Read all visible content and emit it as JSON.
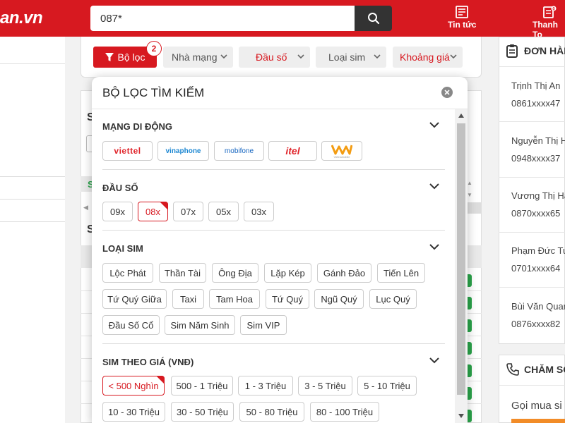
{
  "header": {
    "logo_text": "an.vn",
    "search_value": "087*",
    "news_label": "Tin tức",
    "checkout_label": "Thanh To"
  },
  "filter_bar": {
    "filter_label": "Bộ lọc",
    "filter_count": "2",
    "dropdowns": [
      "Nhà mạng",
      "Đầu số",
      "Loại sim",
      "Khoảng giá"
    ]
  },
  "background": {
    "s_letters": [
      "S",
      "S",
      "S"
    ]
  },
  "right": {
    "orders_title": "ĐƠN HÀNG",
    "orders": [
      {
        "name": "Trịnh Thị An",
        "phone": "0861xxxx47"
      },
      {
        "name": "Nguyễn Thị Hu",
        "phone": "0948xxxx37"
      },
      {
        "name": "Vương Thị Hằ",
        "phone": "0870xxxx65"
      },
      {
        "name": "Phạm Đức Tu",
        "phone": "0701xxxx64"
      },
      {
        "name": "Bùi Văn Quang",
        "phone": "0876xxxx82"
      }
    ],
    "care_title": "CHĂM SÓ",
    "care_text": "Gọi mua si"
  },
  "modal": {
    "title": "BỘ LỌC TÌM KIẾM",
    "sections": {
      "network": {
        "title": "MẠNG DI ĐỘNG",
        "carriers": [
          "viettel",
          "vinaphone",
          "mobifone",
          "itel",
          "Vietnamobile"
        ]
      },
      "prefix": {
        "title": "ĐẦU SỐ",
        "options": [
          "09x",
          "08x",
          "07x",
          "05x",
          "03x"
        ],
        "selected": "08x"
      },
      "type": {
        "title": "LOẠI SIM",
        "options": [
          "Lộc Phát",
          "Thần Tài",
          "Ông Địa",
          "Lặp Kép",
          "Gánh Đảo",
          "Tiến Lên",
          "Tứ Quý Giữa",
          "Taxi",
          "Tam Hoa",
          "Tứ Quý",
          "Ngũ Quý",
          "Lục Quý",
          "Đầu Số Cổ",
          "Sim Năm Sinh",
          "Sim VIP"
        ]
      },
      "price": {
        "title": "SIM THEO GIÁ (VNĐ)",
        "options": [
          "< 500 Nghìn",
          "500 - 1 Triệu",
          "1 - 3 Triệu",
          "3 - 5 Triệu",
          "5 - 10 Triệu",
          "10 - 30 Triệu",
          "30 - 50 Triệu",
          "50 - 80 Triệu",
          "80 - 100 Triệu"
        ],
        "selected": "< 500 Nghìn"
      }
    }
  },
  "colors": {
    "brand_red": "#d71920",
    "viettel": "#e0252b",
    "vinaphone": "#1e88d2",
    "mobifone": "#1565c0",
    "itel": "#e0252b",
    "vietnamobile": "#f39c12"
  }
}
